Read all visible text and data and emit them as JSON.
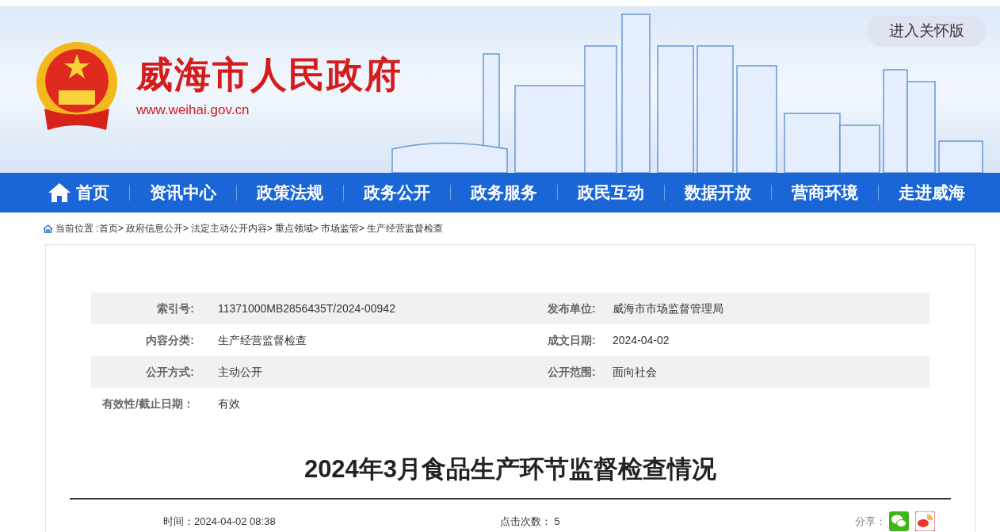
{
  "header": {
    "site_title": "威海市人民政府",
    "site_url": "www.weihai.gov.cn",
    "care_button": "进入关怀版"
  },
  "nav": [
    "首页",
    "资讯中心",
    "政策法规",
    "政务公开",
    "政务服务",
    "政民互动",
    "数据开放",
    "营商环境",
    "走进威海"
  ],
  "breadcrumb": {
    "label": "当前位置 :",
    "items": [
      "首页>",
      "政府信息公开>",
      "法定主动公开内容>",
      "重点领域>",
      "市场监管>",
      "生产经营监督检查"
    ]
  },
  "meta": [
    {
      "label": "索引号:",
      "value": "11371000MB2856435T/2024-00942",
      "label_2": "发布单位:",
      "value_2": "威海市市场监督管理局"
    },
    {
      "label": "内容分类:",
      "value": "生产经营监督检查",
      "label_2": "成文日期:",
      "value_2": "2024-04-02"
    },
    {
      "label": "公开方式:",
      "value": "主动公开",
      "label_2": "公开范围:",
      "value_2": "面向社会"
    },
    {
      "label": "有效性/截止日期：",
      "value": "有效"
    }
  ],
  "article": {
    "title": "2024年3月食品生产环节监督检查情况",
    "time": "时间：2024-04-02 08:38",
    "clicks": "点击次数： 5",
    "share_label": "分享："
  }
}
